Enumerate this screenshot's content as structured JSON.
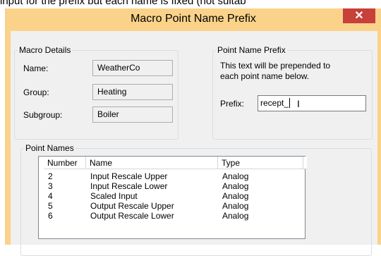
{
  "background_text": "input for the prefix but each name is fixed (not suitab",
  "dialog": {
    "title": "Macro Point Name Prefix",
    "close_glyph": "✕"
  },
  "macro_details": {
    "legend": "Macro Details",
    "name_label": "Name:",
    "name_value": "WeatherCo",
    "group_label": "Group:",
    "group_value": "Heating",
    "subgroup_label": "Subgroup:",
    "subgroup_value": "Boiler"
  },
  "prefix_panel": {
    "legend": "Point Name Prefix",
    "description_line1": "This text will be prepended to",
    "description_line2": "each point name below.",
    "prefix_label": "Prefix:",
    "prefix_value": "recept_"
  },
  "point_names": {
    "legend": "Point Names",
    "columns": [
      "Number",
      "Name",
      "Type"
    ],
    "rows": [
      {
        "number": "2",
        "name": "Input Rescale Upper",
        "type": "Analog"
      },
      {
        "number": "3",
        "name": "Input Rescale Lower",
        "type": "Analog"
      },
      {
        "number": "4",
        "name": "Scaled Input",
        "type": "Analog"
      },
      {
        "number": "5",
        "name": "Output Rescale Upper",
        "type": "Analog"
      },
      {
        "number": "6",
        "name": "Output Rescale Lower",
        "type": "Analog"
      }
    ]
  },
  "colors": {
    "frame": "#fbd28a",
    "close_button": "#c7403a",
    "client": "#f0f0f0"
  }
}
